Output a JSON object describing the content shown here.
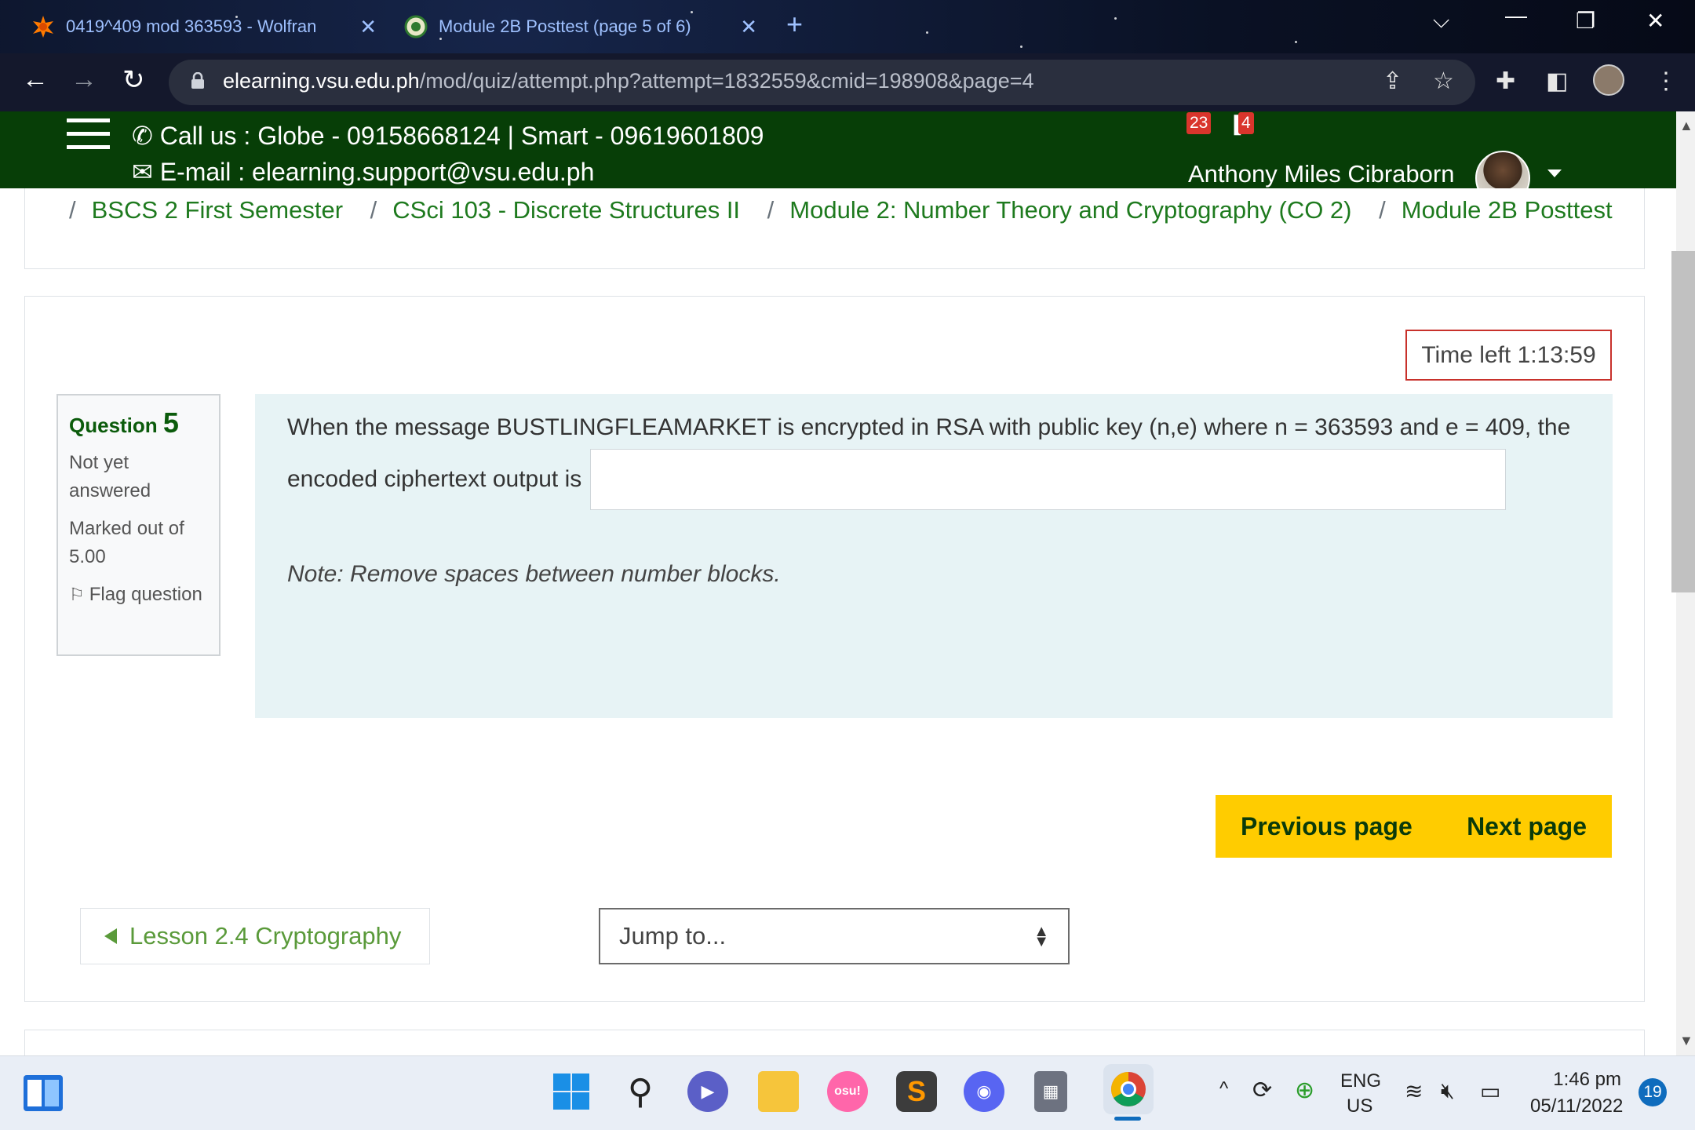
{
  "browser": {
    "tabs": [
      {
        "title": "0419^409 mod 363593 - Wolfran",
        "favicon": "wolfram-star-icon"
      },
      {
        "title": "Module 2B Posttest (page 5 of 6)",
        "favicon": "vsu-seal-icon"
      }
    ],
    "url": {
      "domain": "elearning.vsu.edu.ph",
      "path": "/mod/quiz/attempt.php?attempt=1832559&cmid=198908&page=4"
    }
  },
  "header": {
    "call": "Call us : Globe - 09158668124 | Smart - 09619601809",
    "email": "E-mail : elearning.support@vsu.edu.ph",
    "notifications_count": "23",
    "messages_count": "4",
    "user_name": "Anthony Miles Cibraborn"
  },
  "breadcrumb": {
    "items": [
      "BSCS 2 First Semester",
      "CSci 103 - Discrete Structures II",
      "Module 2: Number Theory and Cryptography (CO 2)",
      "Module 2B Posttest"
    ]
  },
  "quiz": {
    "time_left": "Time left 1:13:59",
    "question_label": "Question",
    "question_number": "5",
    "status": "Not yet answered",
    "marked_out_of": "Marked out of 5.00",
    "flag_label": "Flag question",
    "question_line1": "When the message BUSTLINGFLEAMARKET is encrypted in RSA with public key (n,e) where n = 363593 and e = 409, the",
    "question_line2": "encoded ciphertext output is",
    "answer_value": "",
    "note": "Note: Remove spaces between number blocks.",
    "previous_page": "Previous page",
    "next_page": "Next page"
  },
  "activity_nav": {
    "previous_activity": "Lesson 2.4 Cryptography",
    "jump_to": "Jump to..."
  },
  "taskbar": {
    "language": "ENG",
    "region": "US",
    "time": "1:46 pm",
    "date": "05/11/2022",
    "notification_count": "19",
    "apps": [
      "windows-start-icon",
      "search-icon",
      "meet-icon",
      "file-explorer-icon",
      "osu-icon",
      "sublime-text-icon",
      "discord-icon",
      "calculator-icon",
      "chrome-icon"
    ],
    "osu_label": "osu!"
  }
}
